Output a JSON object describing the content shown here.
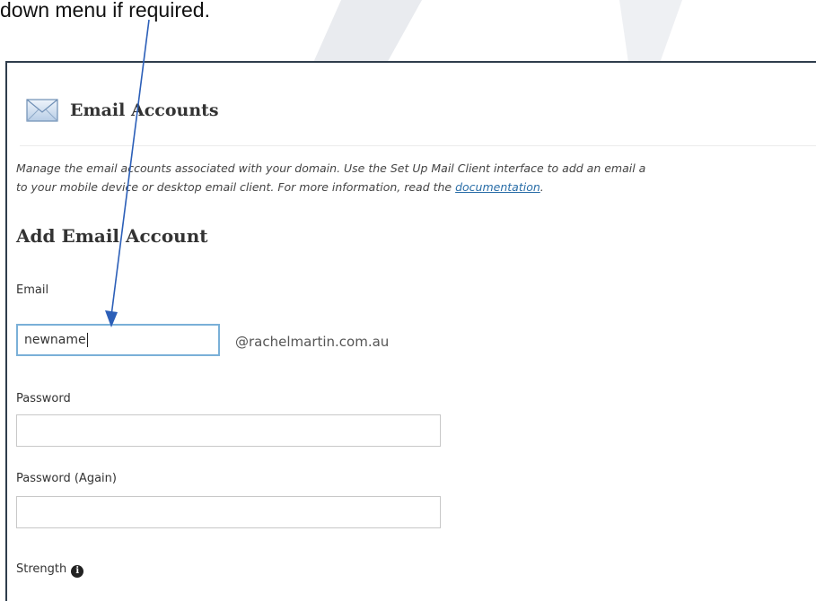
{
  "caption": {
    "text": "down menu if required."
  },
  "page": {
    "title": "Email Accounts",
    "icon": "envelope-icon"
  },
  "description": {
    "line1": "Manage the email accounts associated with your domain. Use the Set Up Mail Client interface to add an email a",
    "line2_prefix": "to your mobile device or desktop email client. For more information, read the ",
    "link_text": "documentation",
    "line2_suffix": "."
  },
  "form": {
    "section_title": "Add Email Account",
    "email_label": "Email",
    "email_value": "newname",
    "domain_suffix": "@rachelmartin.com.au",
    "password_label": "Password",
    "password_value": "",
    "password_again_label": "Password (Again)",
    "password_again_value": "",
    "strength_label": "Strength",
    "strength_info_icon": "info-icon",
    "strength_info_glyph": "i"
  },
  "colors": {
    "frame_border": "#2f3d4c",
    "focus_border": "#7ab0d8",
    "link": "#2a6ea8",
    "arrow": "#2c5fb8"
  }
}
